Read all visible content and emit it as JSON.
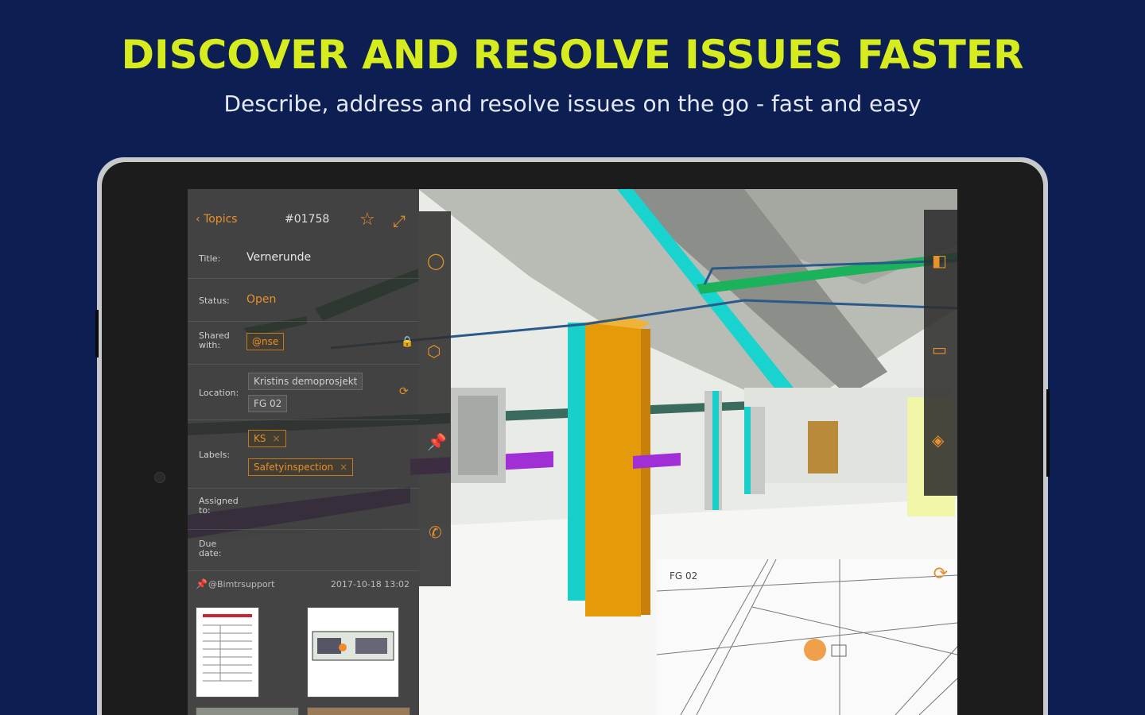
{
  "promo": {
    "headline": "DISCOVER AND RESOLVE ISSUES FASTER",
    "subline": "Describe, address and resolve issues on the go - fast and easy"
  },
  "colors": {
    "background": "#0d1f52",
    "headline": "#d6ec1e",
    "accent": "#e8902a"
  },
  "issue_panel": {
    "back_label": "Topics",
    "back_icon": "chevron-left-icon",
    "issue_id": "#01758",
    "star_icon": "star-icon",
    "expand_icon": "expand-icon",
    "fields": {
      "title_label": "Title:",
      "title_value": "Vernerunde",
      "status_label": "Status:",
      "status_value": "Open",
      "shared_label": "Shared with:",
      "shared_value": "@nse",
      "location_label": "Location:",
      "location_values": [
        "Kristins demoprosjekt",
        "FG 02"
      ],
      "labels_label": "Labels:",
      "labels_values": [
        "KS",
        "Safetyinspection"
      ],
      "assigned_label": "Assigned to:",
      "due_label": "Due date:"
    },
    "comment": {
      "user": "@Bimtrsupport",
      "date": "2017-10-18 13:02"
    }
  },
  "tools": {
    "left_strip": [
      "ellipse-icon",
      "cube-icon",
      "pin-icon",
      "phone-icon"
    ],
    "right_strip": [
      "orange-box-icon",
      "folder-icon",
      "layers-icon"
    ]
  },
  "minimap": {
    "label": "FG 02",
    "refresh_icon": "refresh-icon"
  }
}
